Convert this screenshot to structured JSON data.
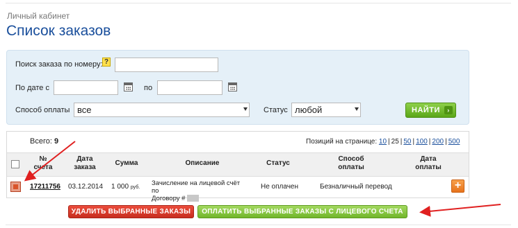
{
  "breadcrumb": "Личный кабинет",
  "page_title": "Список заказов",
  "search": {
    "order_number_label": "Поиск заказа по номеру:",
    "help_icon_text": "?",
    "order_number_value": "",
    "date_from_label": "По дате с",
    "date_from_value": "",
    "date_to_label": "по",
    "date_to_value": "",
    "payment_label": "Способ оплаты",
    "payment_value": "все",
    "status_label": "Статус",
    "status_value": "любой",
    "find_label": "НАЙТИ",
    "find_chevron": "›"
  },
  "orders": {
    "total_label": "Всего:",
    "total_count": "9",
    "per_page_label": "Позиций на странице:",
    "per_page_options": [
      "10",
      "25",
      "50",
      "100",
      "200",
      "500"
    ],
    "per_page_current": "25",
    "columns": {
      "account": [
        "№",
        "счета"
      ],
      "date": [
        "Дата",
        "заказа"
      ],
      "sum": "Сумма",
      "description": "Описание",
      "status": "Статус",
      "payment": [
        "Способ",
        "оплаты"
      ],
      "pay_date": [
        "Дата",
        "оплаты"
      ]
    },
    "rows": [
      {
        "checked": true,
        "account": "17211756",
        "date": "03.12.2014",
        "sum": "1 000",
        "sum_unit": "руб.",
        "description_line1": "Зачисление на лицевой счёт по",
        "description_line2": "Договору #",
        "status": "Не оплачен",
        "payment": "Безналичный перевод",
        "pay_date": "",
        "action_icon": "+"
      }
    ]
  },
  "actions": {
    "delete_label": "УДАЛИТЬ ВЫБРАННЫЕ ЗАКАЗЫ",
    "pay_label": "ОПЛАТИТЬ ВЫБРАННЫЕ ЗАКАЗЫ С ЛИЦЕВОГО СЧЕТА"
  },
  "colors": {
    "title": "#1a4f9c",
    "find_button": "#5aa618",
    "delete_button": "#c72d1f",
    "pay_button": "#71b62a",
    "plus_button": "#e7731c",
    "annotation_arrow": "#e02020"
  }
}
